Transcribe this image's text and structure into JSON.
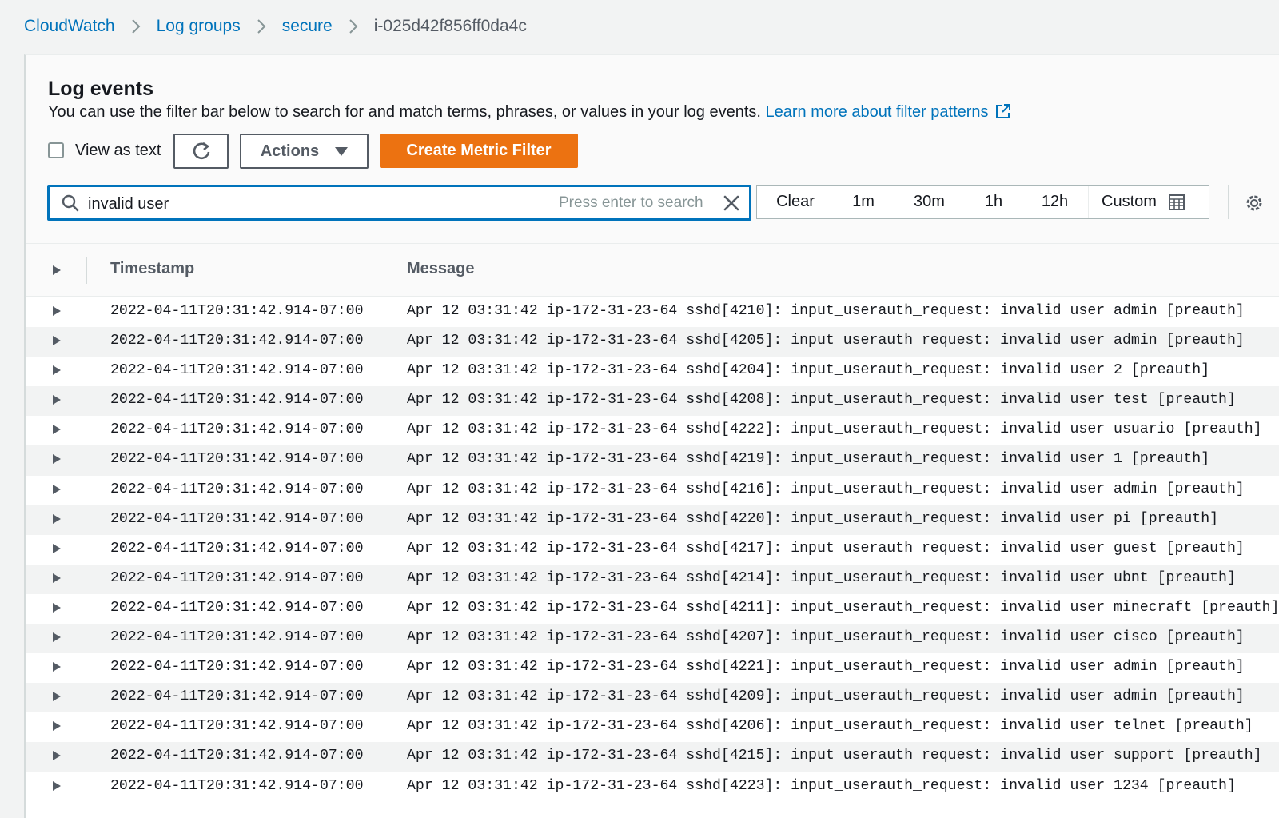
{
  "breadcrumb": {
    "items": [
      {
        "label": "CloudWatch"
      },
      {
        "label": "Log groups"
      },
      {
        "label": "secure"
      }
    ],
    "current": "i-025d42f856ff0da4c"
  },
  "panel": {
    "title": "Log events",
    "description": "You can use the filter bar below to search for and match terms, phrases, or values in your log events.",
    "learn_more_link": "Learn more about filter patterns"
  },
  "toolbar": {
    "view_as_text_label": "View as text",
    "view_as_text_checked": false,
    "actions_label": "Actions",
    "create_metric_filter_label": "Create Metric Filter"
  },
  "search": {
    "value": "invalid user",
    "hint": "Press enter to search"
  },
  "time_range": {
    "options": [
      "Clear",
      "1m",
      "30m",
      "1h",
      "12h",
      "Custom"
    ]
  },
  "colors": {
    "accent_link": "#0073bb",
    "primary_button": "#ec7211",
    "text": "#16191f"
  },
  "table": {
    "columns": {
      "timestamp": "Timestamp",
      "message": "Message"
    },
    "rows": [
      {
        "timestamp": "2022-04-11T20:31:42.914-07:00",
        "message": "Apr 12 03:31:42 ip-172-31-23-64 sshd[4210]: input_userauth_request: invalid user admin [preauth]"
      },
      {
        "timestamp": "2022-04-11T20:31:42.914-07:00",
        "message": "Apr 12 03:31:42 ip-172-31-23-64 sshd[4205]: input_userauth_request: invalid user admin [preauth]"
      },
      {
        "timestamp": "2022-04-11T20:31:42.914-07:00",
        "message": "Apr 12 03:31:42 ip-172-31-23-64 sshd[4204]: input_userauth_request: invalid user 2 [preauth]"
      },
      {
        "timestamp": "2022-04-11T20:31:42.914-07:00",
        "message": "Apr 12 03:31:42 ip-172-31-23-64 sshd[4208]: input_userauth_request: invalid user test [preauth]"
      },
      {
        "timestamp": "2022-04-11T20:31:42.914-07:00",
        "message": "Apr 12 03:31:42 ip-172-31-23-64 sshd[4222]: input_userauth_request: invalid user usuario [preauth]"
      },
      {
        "timestamp": "2022-04-11T20:31:42.914-07:00",
        "message": "Apr 12 03:31:42 ip-172-31-23-64 sshd[4219]: input_userauth_request: invalid user 1 [preauth]"
      },
      {
        "timestamp": "2022-04-11T20:31:42.914-07:00",
        "message": "Apr 12 03:31:42 ip-172-31-23-64 sshd[4216]: input_userauth_request: invalid user admin [preauth]"
      },
      {
        "timestamp": "2022-04-11T20:31:42.914-07:00",
        "message": "Apr 12 03:31:42 ip-172-31-23-64 sshd[4220]: input_userauth_request: invalid user pi [preauth]"
      },
      {
        "timestamp": "2022-04-11T20:31:42.914-07:00",
        "message": "Apr 12 03:31:42 ip-172-31-23-64 sshd[4217]: input_userauth_request: invalid user guest [preauth]"
      },
      {
        "timestamp": "2022-04-11T20:31:42.914-07:00",
        "message": "Apr 12 03:31:42 ip-172-31-23-64 sshd[4214]: input_userauth_request: invalid user ubnt [preauth]"
      },
      {
        "timestamp": "2022-04-11T20:31:42.914-07:00",
        "message": "Apr 12 03:31:42 ip-172-31-23-64 sshd[4211]: input_userauth_request: invalid user minecraft [preauth]"
      },
      {
        "timestamp": "2022-04-11T20:31:42.914-07:00",
        "message": "Apr 12 03:31:42 ip-172-31-23-64 sshd[4207]: input_userauth_request: invalid user cisco [preauth]"
      },
      {
        "timestamp": "2022-04-11T20:31:42.914-07:00",
        "message": "Apr 12 03:31:42 ip-172-31-23-64 sshd[4221]: input_userauth_request: invalid user admin [preauth]"
      },
      {
        "timestamp": "2022-04-11T20:31:42.914-07:00",
        "message": "Apr 12 03:31:42 ip-172-31-23-64 sshd[4209]: input_userauth_request: invalid user admin [preauth]"
      },
      {
        "timestamp": "2022-04-11T20:31:42.914-07:00",
        "message": "Apr 12 03:31:42 ip-172-31-23-64 sshd[4206]: input_userauth_request: invalid user telnet [preauth]"
      },
      {
        "timestamp": "2022-04-11T20:31:42.914-07:00",
        "message": "Apr 12 03:31:42 ip-172-31-23-64 sshd[4215]: input_userauth_request: invalid user support [preauth]"
      },
      {
        "timestamp": "2022-04-11T20:31:42.914-07:00",
        "message": "Apr 12 03:31:42 ip-172-31-23-64 sshd[4223]: input_userauth_request: invalid user 1234 [preauth]"
      }
    ]
  }
}
